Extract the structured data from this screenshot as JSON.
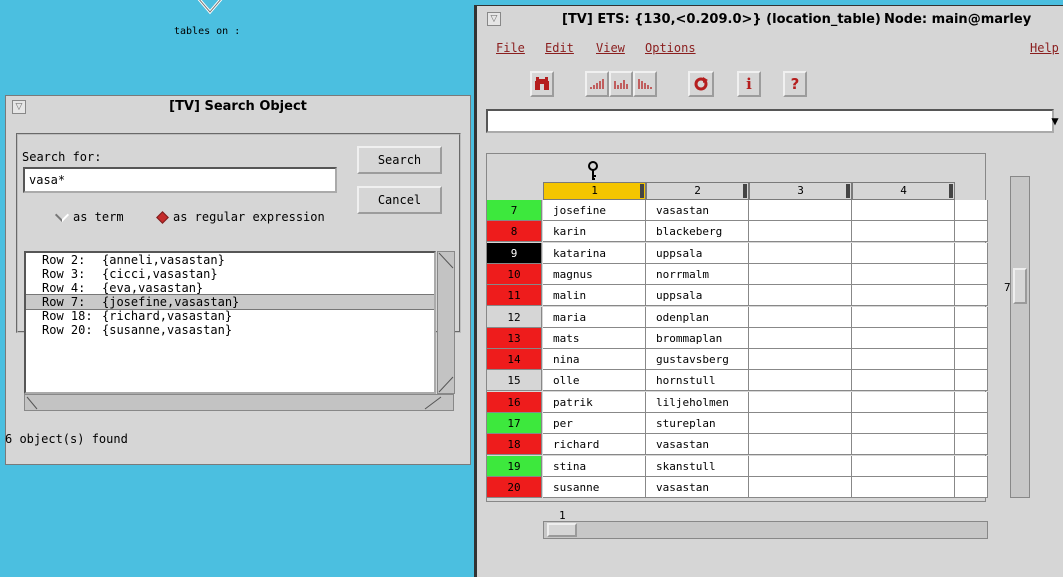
{
  "desktop": {
    "icon_label": "tables on :"
  },
  "search_window": {
    "title": "[TV]  Search Object",
    "search_label": "Search for:",
    "search_value": "vasa*",
    "search_button": "Search",
    "cancel_button": "Cancel",
    "option_term": "as term",
    "option_regex": "as regular expression",
    "selected_option": "as regular expression",
    "results": [
      {
        "row": "Row 2:",
        "value": "{anneli,vasastan}",
        "selected": false
      },
      {
        "row": "Row 3:",
        "value": "{cicci,vasastan}",
        "selected": false
      },
      {
        "row": "Row 4:",
        "value": "{eva,vasastan}",
        "selected": false
      },
      {
        "row": "Row 7:",
        "value": "{josefine,vasastan}",
        "selected": true
      },
      {
        "row": "Row 18:",
        "value": "{richard,vasastan}",
        "selected": false
      },
      {
        "row": "Row 20:",
        "value": "{susanne,vasastan}",
        "selected": false
      }
    ],
    "status": "6 object(s) found"
  },
  "tv_window": {
    "title": "[TV]  ETS: {130,<0.209.0>} (location_table)",
    "node": "Node: main@marley",
    "menu": {
      "file": "File",
      "edit": "Edit",
      "view": "View",
      "options": "Options",
      "help": "Help"
    },
    "toolbar_icons": [
      "search-icon",
      "sort-ascending-icon",
      "sort-descending-icon",
      "no-sort-icon",
      "refresh-icon",
      "info-icon",
      "help-icon"
    ],
    "columns": [
      "1",
      "2",
      "3",
      "4"
    ],
    "sorted_column": "1",
    "rows": [
      {
        "num": "7",
        "c1": "josefine",
        "c2": "vasastan",
        "color": "#3de83d",
        "text_color": "#000000"
      },
      {
        "num": "8",
        "c1": "karin",
        "c2": "blackeberg",
        "color": "#ee1c1c",
        "text_color": "#000000"
      },
      {
        "num": "9",
        "c1": "katarina",
        "c2": "uppsala",
        "color": "#000000",
        "text_color": "#ffffff"
      },
      {
        "num": "10",
        "c1": "magnus",
        "c2": "norrmalm",
        "color": "#ee1c1c",
        "text_color": "#000000"
      },
      {
        "num": "11",
        "c1": "malin",
        "c2": "uppsala",
        "color": "#ee1c1c",
        "text_color": "#000000"
      },
      {
        "num": "12",
        "c1": "maria",
        "c2": "odenplan",
        "color": "#d6d6d6",
        "text_color": "#000000"
      },
      {
        "num": "13",
        "c1": "mats",
        "c2": "brommaplan",
        "color": "#ee1c1c",
        "text_color": "#000000"
      },
      {
        "num": "14",
        "c1": "nina",
        "c2": "gustavsberg",
        "color": "#ee1c1c",
        "text_color": "#000000"
      },
      {
        "num": "15",
        "c1": "olle",
        "c2": "hornstull",
        "color": "#d6d6d6",
        "text_color": "#000000"
      },
      {
        "num": "16",
        "c1": "patrik",
        "c2": "liljeholmen",
        "color": "#ee1c1c",
        "text_color": "#000000"
      },
      {
        "num": "17",
        "c1": "per",
        "c2": "stureplan",
        "color": "#3de83d",
        "text_color": "#000000"
      },
      {
        "num": "18",
        "c1": "richard",
        "c2": "vasastan",
        "color": "#ee1c1c",
        "text_color": "#000000"
      },
      {
        "num": "19",
        "c1": "stina",
        "c2": "skanstull",
        "color": "#3de83d",
        "text_color": "#000000"
      },
      {
        "num": "20",
        "c1": "susanne",
        "c2": "vasastan",
        "color": "#ee1c1c",
        "text_color": "#000000"
      }
    ],
    "vscroll_value": "7",
    "hscroll_value": "1"
  }
}
